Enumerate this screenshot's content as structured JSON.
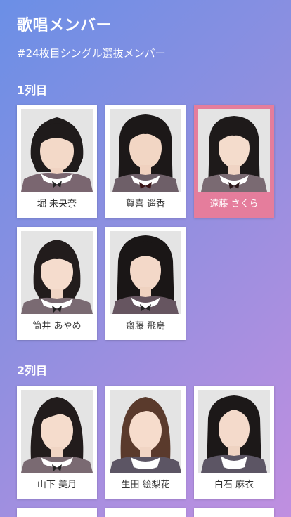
{
  "header": {
    "title": "歌唱メンバー",
    "subtitle": "#24枚目シングル選抜メンバー"
  },
  "rows": [
    {
      "label": "1列目",
      "members": [
        {
          "name": "堀 未央奈",
          "selected": false
        },
        {
          "name": "賀喜 遥香",
          "selected": false
        },
        {
          "name": "遠藤 さくら",
          "selected": true
        },
        {
          "name": "筒井 あやめ",
          "selected": false
        },
        {
          "name": "齋藤 飛鳥",
          "selected": false
        }
      ]
    },
    {
      "label": "2列目",
      "members": [
        {
          "name": "山下 美月",
          "selected": false
        },
        {
          "name": "生田 絵梨花",
          "selected": false
        },
        {
          "name": "白石 麻衣",
          "selected": false
        }
      ]
    }
  ],
  "colors": {
    "gradient_start": "#6b8fe6",
    "gradient_end": "#c08fe0",
    "selected_card": "#e57d9c"
  }
}
